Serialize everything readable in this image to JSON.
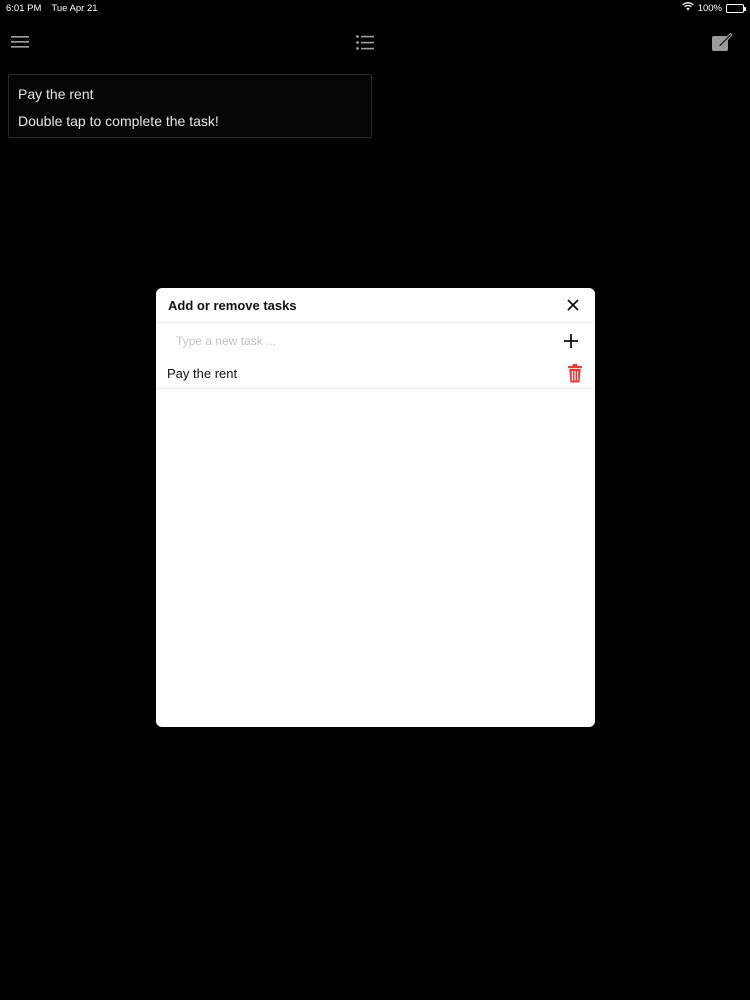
{
  "status_bar": {
    "time": "6:01 PM",
    "date": "Tue Apr 21",
    "battery_text": "100%",
    "wifi_icon": "wifi-icon",
    "battery_level": 1.0
  },
  "toolbar": {
    "menu_icon": "hamburger-menu-icon",
    "list_icon": "list-icon",
    "edit_icon": "compose-icon"
  },
  "task_card": {
    "title": "Pay the rent",
    "hint": "Double tap to complete the task!"
  },
  "modal": {
    "title": "Add or remove tasks",
    "close_icon": "close-icon",
    "input": {
      "placeholder": "Type a new task ...",
      "value": ""
    },
    "add_icon": "plus-icon",
    "tasks": [
      {
        "label": "Pay the rent",
        "delete_icon": "trash-icon"
      }
    ]
  },
  "colors": {
    "background": "#000000",
    "modal_background": "#ffffff",
    "delete_red": "#e23b3b",
    "icon_gray": "#9a9a9a"
  }
}
